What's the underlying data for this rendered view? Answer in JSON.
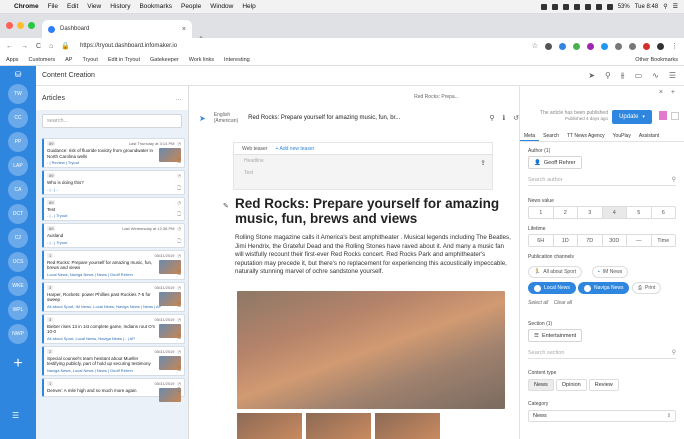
{
  "menubar": {
    "items": [
      "Chrome",
      "File",
      "Edit",
      "View",
      "History",
      "Bookmarks",
      "People",
      "Window",
      "Help"
    ],
    "battery": "53%",
    "clock": "Tue 8:48"
  },
  "browser": {
    "tab_title": "Dashboard",
    "url": "https://tryout.dashboard.infomaker.io",
    "bookmarks": [
      "Apps",
      "Customers",
      "AP",
      "Tryout",
      "Edit in Tryout",
      "Gatekeeper",
      "Work links",
      "Interesting"
    ],
    "other_bookmarks": "Other Bookmarks"
  },
  "rail": {
    "items": [
      "TW",
      "CC",
      "PP",
      "LAP",
      "CA",
      "DCT",
      "C2",
      "OCS",
      "WKE",
      "WPL",
      "NWP"
    ]
  },
  "app": {
    "title": "Content Creation"
  },
  "articles": {
    "header": "Articles",
    "search_placeholder": "search...",
    "cards": [
      {
        "num": "89",
        "date": "Last Thursday at 3:14 PM",
        "title": "Guidance: risk of fluoride toxicity from groundwater in North Carolina wells",
        "meta": "- | Review | Tryout"
      },
      {
        "num": "89",
        "date": "",
        "title": "Who is doing this?",
        "meta": "- | - | -"
      },
      {
        "num": "89",
        "date": "",
        "title": "Test",
        "meta": "- | - | Tryout"
      },
      {
        "num": "89",
        "date": "Last Wednesday at 12:38 PM",
        "title": "Ausland",
        "meta": "- | - | Tryout"
      },
      {
        "num": "1",
        "date": "05/31/2019",
        "title": "Red Rocks: Prepare yourself for amazing music, fun, brews and views",
        "meta": "Local News, Naviga News | News | Geoff Rehrer"
      },
      {
        "num": "3",
        "date": "05/31/2019",
        "title": "Harper, Rockets: power Phillies past Rockies 7-5 for sweep",
        "meta": "All about Sport, IM News, Local News, Naviga News | News | AP"
      },
      {
        "num": "3",
        "date": "05/31/2019",
        "title": "Bieber rises 13 in 1st complete game, Indians rout O's 10-0",
        "meta": "All about Sport, Local News, Naviga News | - | AP"
      },
      {
        "num": "2",
        "date": "05/31/2019",
        "title": "Special counsel's team hesitant about Mueller testifying publicly, part of hold up securing testimony",
        "meta": "Naviga News, Local News | News | Geoff Rehrer"
      },
      {
        "num": "1",
        "date": "05/31/2019",
        "title": "Denver: A mile high and so much more again",
        "meta": ""
      }
    ]
  },
  "editor": {
    "doc_tab": "Red Rocks: Prepa...",
    "language_line1": "English",
    "language_line2": "(American)",
    "title_short": "Red Rocks: Prepare yourself for amazing music, fun, br...",
    "teaser_tab": "Web teaser",
    "teaser_add": "+ Add new teaser",
    "teaser_headline": "Headline",
    "teaser_text": "Text",
    "headline": "Red Rocks: Prepare yourself for amazing music, fun, brews and views",
    "body": "Rolling Stone magazine calls it America's best amphitheater . Musical legends including The Beatles, Jimi Hendrix, the Grateful Dead and the Rolling Stones have raved about it. And many a music fan will wistfully recount their first-ever Red Rocks concert. Red Rocks Park and amphitheater's reputation may precede it, but there's no replacement for experiencing this acoustically impeccable, naturally stunning marvel of ochre sandstone yourself."
  },
  "sidebar": {
    "status": "The article has been published",
    "status_sub": "Published 4 days ago",
    "update_label": "Update",
    "tabs": [
      "Meta",
      "Search",
      "TT News Agency",
      "YouPlay",
      "Assistant"
    ],
    "author_label": "Author (1)",
    "author": "Geoff Rehrer",
    "author_search": "Search author",
    "news_value_label": "News value",
    "news_values": [
      "1",
      "2",
      "3",
      "4",
      "5",
      "6"
    ],
    "lifetime_label": "Lifetime",
    "lifetimes": [
      "6H",
      "1D",
      "7D",
      "30D",
      "—",
      "Time"
    ],
    "channels_label": "Publication channels",
    "channels": [
      {
        "name": "All about Sport",
        "on": false
      },
      {
        "name": "IM News",
        "on": false
      },
      {
        "name": "Local News",
        "on": true
      },
      {
        "name": "Naviga News",
        "on": true
      },
      {
        "name": "Print",
        "on": false
      }
    ],
    "select_all": "Select all",
    "clear_all": "Clear all",
    "section_label": "Section (1)",
    "section": "Entertainment",
    "section_search": "Search section",
    "content_type_label": "Content type",
    "content_types": [
      "News",
      "Opinion",
      "Review"
    ],
    "category_label": "Category",
    "category_value": "News"
  },
  "colors": {
    "accent": "#2e86de",
    "rail": "#2e86de"
  }
}
